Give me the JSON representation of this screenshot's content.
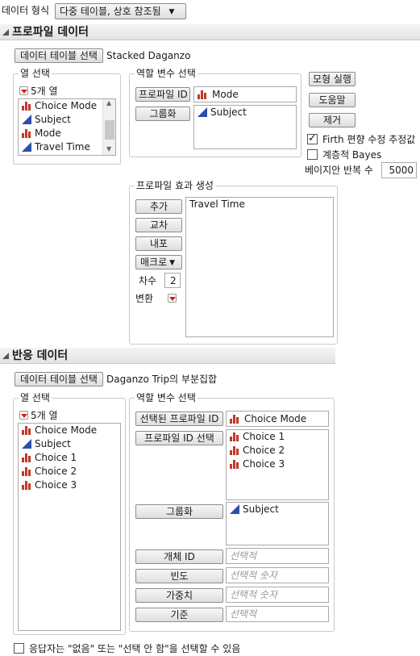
{
  "top": {
    "data_format_label": "데이터 형식",
    "data_format_value": "다중 테이블, 상호 참조됨"
  },
  "profile": {
    "title": "프로파일 데이터",
    "select_table_btn": "데이터 테이블 선택",
    "table_name": "Stacked Daganzo",
    "columns_group": "열 선택",
    "columns_count": "5개 열",
    "columns": [
      {
        "name": "Choice Mode",
        "type": "nominal"
      },
      {
        "name": "Subject",
        "type": "continuous"
      },
      {
        "name": "Mode",
        "type": "nominal"
      },
      {
        "name": "Travel Time",
        "type": "continuous"
      }
    ],
    "roles_group": "역할 변수 선택",
    "profile_id_btn": "프로파일 ID",
    "profile_id_value": "Mode",
    "grouping_btn": "그룹화",
    "grouping_value": "Subject",
    "run_btn": "모형 실행",
    "help_btn": "도움말",
    "remove_btn": "제거",
    "firth_label": "Firth 편향 수정 추정값",
    "firth_checked": true,
    "bayes_label": "계층적 Bayes",
    "bayes_checked": false,
    "bayes_iter_label": "베이지안 반복 수",
    "bayes_iter_value": "5000",
    "effects_group": "프로파일 효과 생성",
    "add_btn": "추가",
    "cross_btn": "교차",
    "nest_btn": "내포",
    "macro_btn": "매크로",
    "degree_label": "차수",
    "degree_value": "2",
    "transform_label": "변환",
    "effects": [
      "Travel Time"
    ]
  },
  "response": {
    "title": "반응 데이터",
    "select_table_btn": "데이터 테이블 선택",
    "table_name": "Daganzo Trip의 부분집합",
    "columns_group": "열 선택",
    "columns_count": "5개 열",
    "columns": [
      {
        "name": "Choice Mode",
        "type": "nominal"
      },
      {
        "name": "Subject",
        "type": "continuous"
      },
      {
        "name": "Choice 1",
        "type": "nominal"
      },
      {
        "name": "Choice 2",
        "type": "nominal"
      },
      {
        "name": "Choice 3",
        "type": "nominal"
      }
    ],
    "roles_group": "역할 변수 선택",
    "selected_profile_id_btn": "선택된 프로파일 ID",
    "selected_profile_id_value": "Choice Mode",
    "profile_id_select_btn": "프로파일 ID 선택",
    "profile_id_select_values": [
      "Choice 1",
      "Choice 2",
      "Choice 3"
    ],
    "grouping_btn": "그룹화",
    "grouping_value": "Subject",
    "subject_id_btn": "개체 ID",
    "subject_id_placeholder": "선택적",
    "freq_btn": "빈도",
    "freq_placeholder": "선택적 숫자",
    "weight_btn": "가중치",
    "weight_placeholder": "선택적 숫자",
    "by_btn": "기준",
    "by_placeholder": "선택적"
  },
  "footer": {
    "none_option_label": "응답자는 \"없음\" 또는 \"선택 안 함\"을 선택할 수 있음",
    "none_option_checked": false
  },
  "colors": {
    "nominal_icon": "#c0392b",
    "continuous_icon": "#2b4fa8",
    "dropdown_arrow": "#d32020"
  }
}
